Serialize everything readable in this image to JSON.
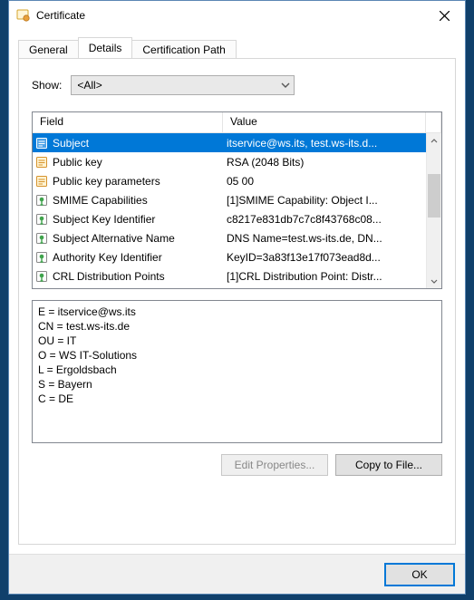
{
  "window": {
    "title": "Certificate"
  },
  "tabs": {
    "general": "General",
    "details": "Details",
    "certpath": "Certification Path",
    "active": "details"
  },
  "show": {
    "label": "Show:",
    "value": "<All>"
  },
  "listview": {
    "headers": {
      "field": "Field",
      "value": "Value"
    },
    "rows": [
      {
        "icon": "prop",
        "selected": true,
        "field": "Subject",
        "value": "itservice@ws.its, test.ws-its.d..."
      },
      {
        "icon": "prop",
        "selected": false,
        "field": "Public key",
        "value": "RSA (2048 Bits)"
      },
      {
        "icon": "prop",
        "selected": false,
        "field": "Public key parameters",
        "value": "05 00"
      },
      {
        "icon": "ext",
        "selected": false,
        "field": "SMIME Capabilities",
        "value": "[1]SMIME Capability: Object I..."
      },
      {
        "icon": "ext",
        "selected": false,
        "field": "Subject Key Identifier",
        "value": "c8217e831db7c7c8f43768c08..."
      },
      {
        "icon": "ext",
        "selected": false,
        "field": "Subject Alternative Name",
        "value": "DNS Name=test.ws-its.de, DN..."
      },
      {
        "icon": "ext",
        "selected": false,
        "field": "Authority Key Identifier",
        "value": "KeyID=3a83f13e17f073ead8d..."
      },
      {
        "icon": "ext",
        "selected": false,
        "field": "CRL Distribution Points",
        "value": "[1]CRL Distribution Point: Distr..."
      }
    ]
  },
  "detail_lines": [
    "E = itservice@ws.its",
    "CN = test.ws-its.de",
    "OU = IT",
    "O = WS IT-Solutions",
    "L = Ergoldsbach",
    "S = Bayern",
    "C = DE"
  ],
  "buttons": {
    "edit_properties": "Edit Properties...",
    "copy_to_file": "Copy to File...",
    "ok": "OK"
  }
}
